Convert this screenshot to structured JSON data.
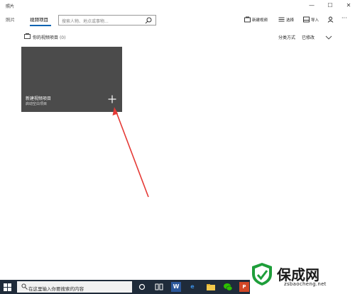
{
  "window": {
    "app_title": "照片",
    "minimize": "—",
    "maximize": "☐",
    "close": "✕"
  },
  "toolbar": {
    "tabs": [
      {
        "label": "照片",
        "selected": false
      },
      {
        "label": "视频项目",
        "selected": true
      }
    ],
    "search_placeholder": "搜索人物、地点或事物...",
    "new_video_label": "新建视频",
    "select_label": "选择",
    "import_label": "导入",
    "more_label": "···"
  },
  "section": {
    "title": "你的视频项目",
    "count": "(0)",
    "sort_label": "分类方式",
    "sort_value": "已修改"
  },
  "tile": {
    "title": "新建视频项目",
    "subtitle": "启动空白项目"
  },
  "watermark": {
    "brand": "保成网",
    "url": "zsbaocheng.net"
  },
  "taskbar": {
    "search_text": "在这里输入你要搜索的内容",
    "word_label": "W",
    "edge_label": "e",
    "ppt_label": "P"
  },
  "colors": {
    "accent": "#0063b1",
    "tile_bg": "#4b4b4b",
    "annotation_arrow": "#e53935",
    "taskbar_bg": "#1f2b3a",
    "watermark_green": "#1e9e3a"
  }
}
